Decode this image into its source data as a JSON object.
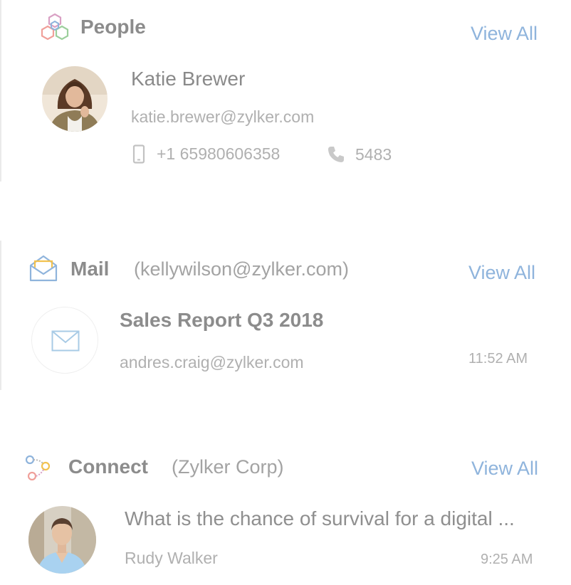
{
  "people": {
    "title": "People",
    "view_all": "View All",
    "contact": {
      "name": "Katie Brewer",
      "email": "katie.brewer@zylker.com",
      "mobile": "+1 65980606358",
      "extension": "5483"
    }
  },
  "mail": {
    "title": "Mail",
    "account": "(kellywilson@zylker.com)",
    "view_all": "View All",
    "message": {
      "subject": "Sales Report Q3 2018",
      "sender": "andres.craig@zylker.com",
      "time": "11:52 AM"
    }
  },
  "connect": {
    "title": "Connect",
    "network": "(Zylker Corp)",
    "view_all": "View All",
    "post": {
      "text": "What is the chance of survival for a digital ...",
      "author": "Rudy Walker",
      "time": "9:25 AM"
    }
  },
  "icons": {
    "people": "people-cubes-icon",
    "mobile": "mobile-phone-icon",
    "phone": "phone-icon",
    "mail": "open-envelope-icon",
    "envelope": "envelope-icon",
    "connect": "connect-network-icon"
  },
  "colors": {
    "link": "#8fb4dc",
    "heading": "#8c8c8c",
    "muted": "#b0b0b0"
  }
}
